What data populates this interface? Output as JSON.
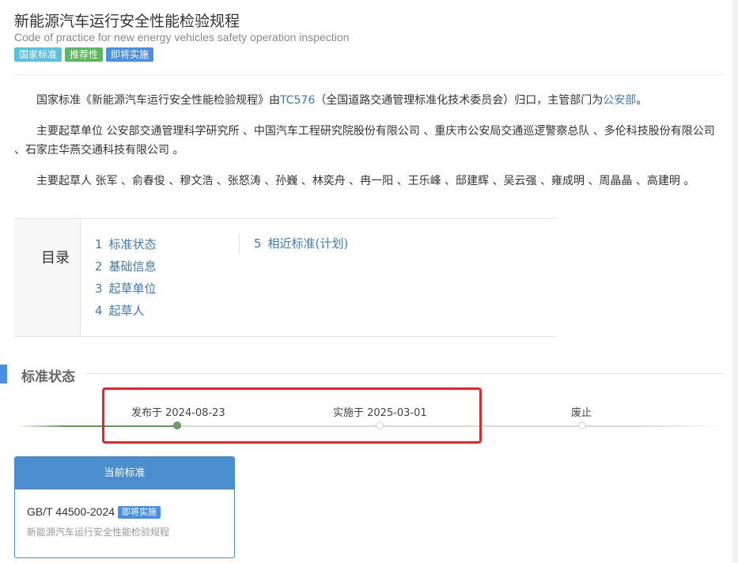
{
  "header": {
    "title": "新能源汽车运行安全性能检验规程",
    "subtitle": "Code of practice for new energy vehicles safety operation inspection",
    "tags": [
      "国家标准",
      "推荐性",
      "即将实施"
    ]
  },
  "intro": {
    "p1_pre": "国家标准《新能源汽车运行安全性能检验规程》由",
    "p1_tc": "TC576",
    "p1_mid": "（全国道路交通管理标准化技术委员会）归口，主管部门为",
    "p1_dept": "公安部",
    "p1_end": "。",
    "p2": "主要起草单位 公安部交通管理科学研究所 、中国汽车工程研究院股份有限公司 、重庆市公安局交通巡逻警察总队 、多伦科技股份有限公司 、石家庄华燕交通科技有限公司 。",
    "p3": "主要起草人 张军 、俞春俊 、穆文浩 、张怒涛 、孙巍 、林奕舟 、冉一阳 、王乐峰 、邸建辉 、吴云强 、雍成明 、周晶晶 、高建明 。"
  },
  "toc": {
    "title": "目录",
    "items": [
      {
        "num": "1",
        "label": "标准状态"
      },
      {
        "num": "2",
        "label": "基础信息"
      },
      {
        "num": "3",
        "label": "起草单位"
      },
      {
        "num": "4",
        "label": "起草人"
      },
      {
        "num": "5",
        "label": "相近标准(计划)"
      }
    ]
  },
  "status_section": {
    "title": "标准状态",
    "timeline": [
      {
        "label": "发布于 2024-08-23",
        "state": "done"
      },
      {
        "label": "实施于 2025-03-01",
        "state": "pending"
      },
      {
        "label": "废止",
        "state": "pending"
      }
    ]
  },
  "current_card": {
    "header": "当前标准",
    "code": "GB/T 44500-2024",
    "badge": "即将实施",
    "name": "新能源汽车运行安全性能检验规程"
  },
  "colors": {
    "link": "#3d7ab6",
    "accent_blue": "#4a90e2",
    "timeline_green": "#5e9a55",
    "highlight_red": "#e8232c"
  }
}
